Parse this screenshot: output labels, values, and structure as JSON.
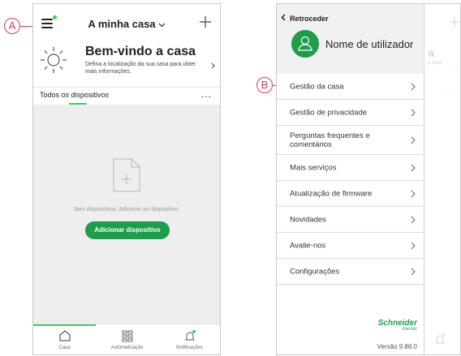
{
  "callouts": {
    "a": "A",
    "b": "B"
  },
  "phone1": {
    "header_title": "A minha casa",
    "welcome": {
      "title": "Bem-vindo a casa",
      "subtitle": "Defina a localização da sua casa para obter mais informações."
    },
    "devices_label": "Todos os dispositivos",
    "more": "...",
    "empty_message": "Sem dispositivos. Adicione um dispositivo.",
    "add_device_label": "Adicionar dispositivo",
    "tabs": [
      {
        "label": "Casa",
        "icon": "home-icon"
      },
      {
        "label": "Automatização",
        "icon": "grid-icon"
      },
      {
        "label": "Notificações",
        "icon": "bell-icon"
      }
    ]
  },
  "phone2": {
    "back_label": "Retroceder",
    "user_name": "Nome de utilizador",
    "menu": [
      {
        "label": "Gestão da casa"
      },
      {
        "label": "Gestão de privacidade"
      },
      {
        "label": "Perguntas frequentes e comentários"
      },
      {
        "label": "Mais serviços"
      },
      {
        "label": "Atualização de firmware"
      },
      {
        "label": "Novidades"
      },
      {
        "label": "Avalie-nos"
      },
      {
        "label": "Configurações"
      }
    ],
    "brand_main": "Schneider",
    "brand_sub": "Electric",
    "version": "Versão 9.88.0",
    "background_peek": {
      "a_letter": "a",
      "text": "a obter",
      "more": "..."
    }
  },
  "colors": {
    "accent": "#3dcd58",
    "button": "#1e9e4a",
    "callout": "#d1405a"
  }
}
